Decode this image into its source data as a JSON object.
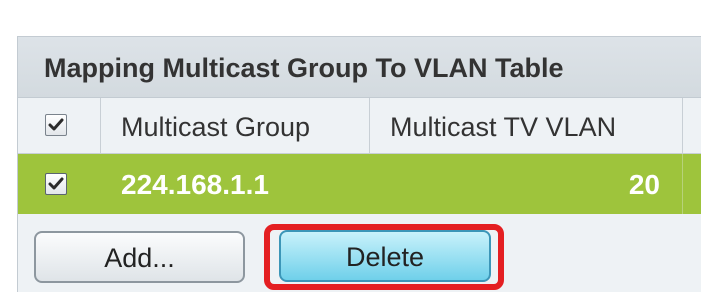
{
  "table": {
    "title": "Mapping Multicast Group To VLAN Table",
    "columns": {
      "select_all_checked": true,
      "multicast_group": "Multicast Group",
      "multicast_tv_vlan": "Multicast TV VLAN"
    },
    "rows": [
      {
        "checked": true,
        "multicast_group": "224.168.1.1",
        "multicast_tv_vlan": "20"
      }
    ]
  },
  "buttons": {
    "add": "Add...",
    "delete": "Delete"
  },
  "colors": {
    "selected_row": "#9ec43c",
    "delete_button": "#6fd0ea",
    "highlight": "#e41f22"
  },
  "icons": {
    "checkbox_checked": "checkmark-icon"
  }
}
